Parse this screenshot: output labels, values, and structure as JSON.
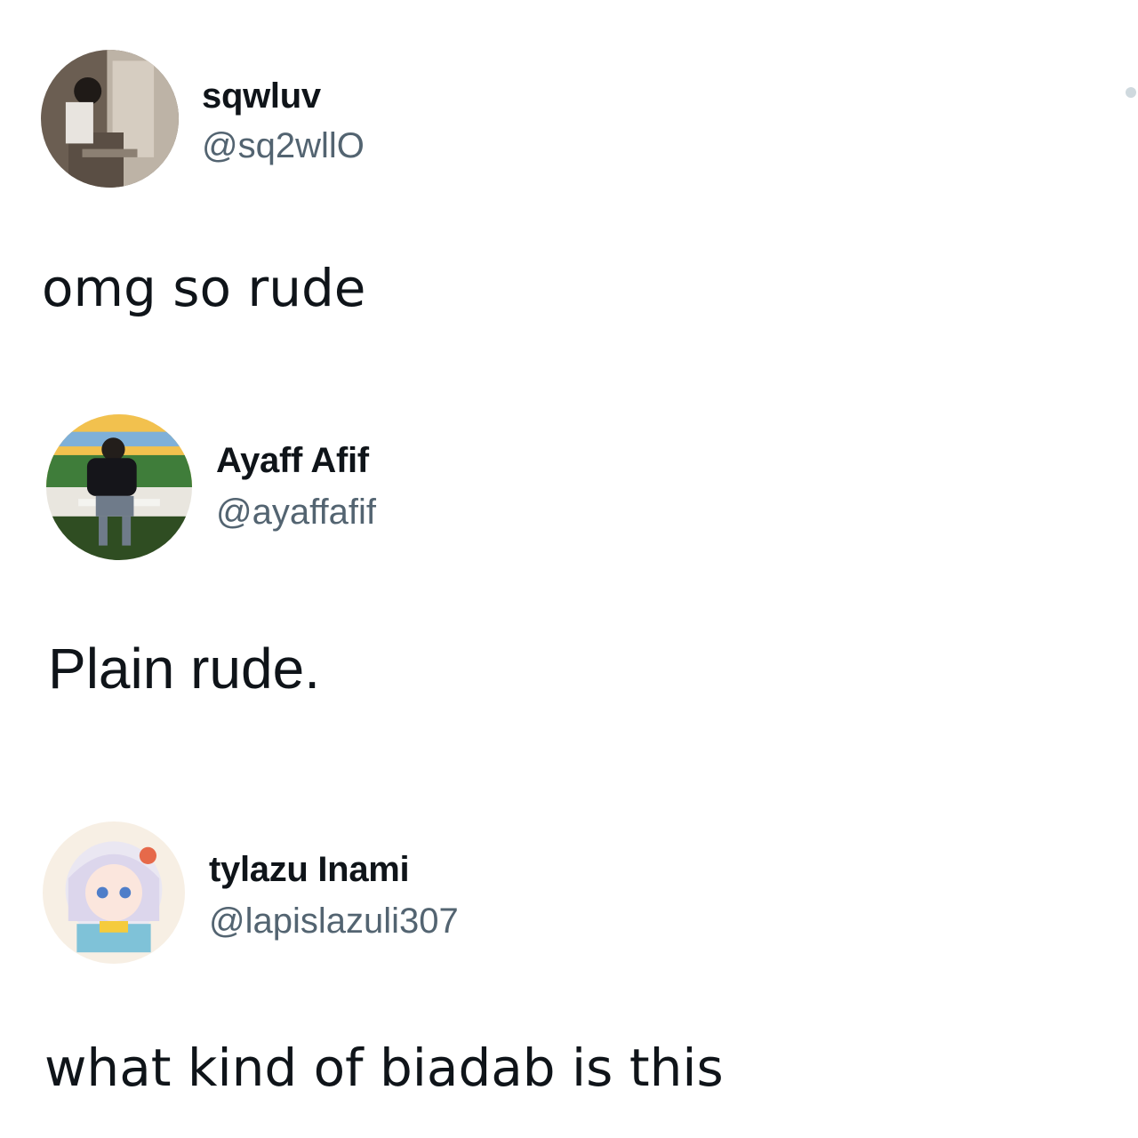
{
  "posts": [
    {
      "name": "sqwluv",
      "handle": "@sq2wllO",
      "text": "omg so rude",
      "avatar_icon": "profile-photo"
    },
    {
      "name": "Ayaff Afif",
      "handle": "@ayaffafif",
      "text": "Plain rude.",
      "avatar_icon": "profile-photo"
    },
    {
      "name": "tylazu Inami",
      "handle": "@lapislazuli307",
      "text": "what kind of biadab is this",
      "avatar_icon": "anime-profile-picture"
    }
  ],
  "colors": {
    "text": "#0f1419",
    "handle": "#536471",
    "background": "#ffffff"
  }
}
